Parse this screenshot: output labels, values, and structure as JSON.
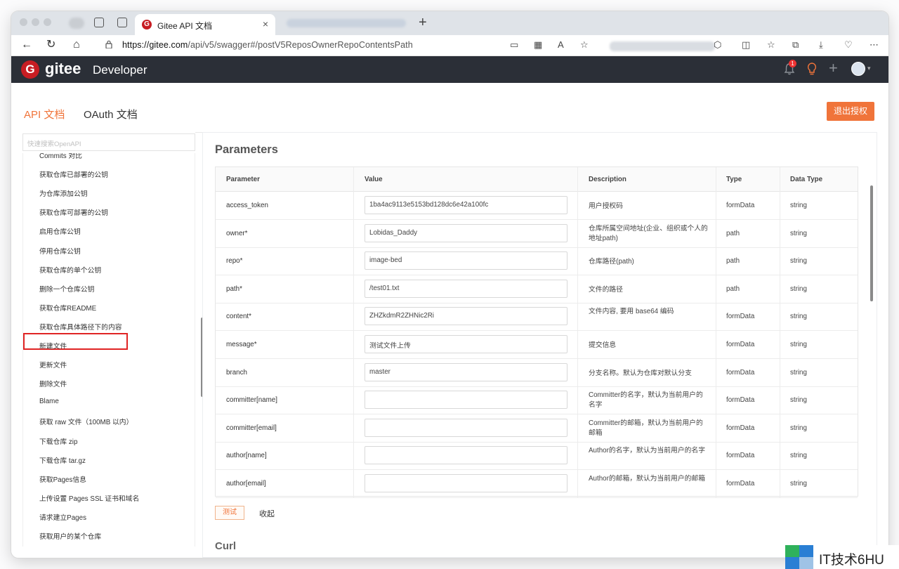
{
  "browser": {
    "tab_title": "Gitee API 文档",
    "tab_close": "×",
    "new_tab": "+",
    "url_host": "https://gitee.com",
    "url_path": "/api/v5/swagger#/postV5ReposOwnerRepoContentsPath"
  },
  "header": {
    "logo_letter": "G",
    "brand": "gitee",
    "section": "Developer",
    "notification_count": "1",
    "plus": "+",
    "caret": "▾"
  },
  "nav": {
    "api_tab": "API 文档",
    "oauth_tab": "OAuth 文档",
    "logout_button": "退出授权"
  },
  "sidebar": {
    "search_placeholder": "快速搜索OpenAPI",
    "items": [
      "Commits 对比",
      "获取仓库已部署的公钥",
      "为仓库添加公钥",
      "获取仓库可部署的公钥",
      "启用仓库公钥",
      "停用仓库公钥",
      "获取仓库的单个公钥",
      "删除一个仓库公钥",
      "获取仓库README",
      "获取仓库具体路径下的内容",
      "新建文件",
      "更新文件",
      "删除文件",
      "Blame",
      "获取 raw 文件（100MB 以内）",
      "下载仓库 zip",
      "下载仓库 tar.gz",
      "获取Pages信息",
      "上传设置 Pages SSL 证书和域名",
      "请求建立Pages",
      "获取用户的某个仓库"
    ]
  },
  "main": {
    "title": "Parameters",
    "columns": {
      "parameter": "Parameter",
      "value": "Value",
      "description": "Description",
      "type": "Type",
      "data_type": "Data Type"
    },
    "rows": [
      {
        "name": "access_token",
        "value": "1ba4ac9113e5153bd128dc6e42a100fc",
        "desc": "用户授权码",
        "type": "formData",
        "dtype": "string"
      },
      {
        "name": "owner*",
        "value": "Lobidas_Daddy",
        "desc": "仓库所属空间地址(企业、组织或个人的地址path)",
        "type": "path",
        "dtype": "string"
      },
      {
        "name": "repo*",
        "value": "image-bed",
        "desc": "仓库路径(path)",
        "type": "path",
        "dtype": "string"
      },
      {
        "name": "path*",
        "value": "/test01.txt",
        "desc": "文件的路径",
        "type": "path",
        "dtype": "string"
      },
      {
        "name": "content*",
        "value": "ZHZkdmR2ZHNic2Ri",
        "desc": "文件内容, 要用 base64 编码",
        "type": "formData",
        "dtype": "string"
      },
      {
        "name": "message*",
        "value": "测试文件上传",
        "desc": "提交信息",
        "type": "formData",
        "dtype": "string"
      },
      {
        "name": "branch",
        "value": "master",
        "desc": "分支名称。默认为仓库对默认分支",
        "type": "formData",
        "dtype": "string"
      },
      {
        "name": "committer[name]",
        "value": "",
        "desc": "Committer的名字，默认为当前用户的名字",
        "type": "formData",
        "dtype": "string"
      },
      {
        "name": "committer[email]",
        "value": "",
        "desc": "Committer的邮箱，默认为当前用户的邮箱",
        "type": "formData",
        "dtype": "string"
      },
      {
        "name": "author[name]",
        "value": "",
        "desc": "Author的名字，默认为当前用户的名字",
        "type": "formData",
        "dtype": "string"
      },
      {
        "name": "author[email]",
        "value": "",
        "desc": "Author的邮箱，默认为当前用户的邮箱",
        "type": "formData",
        "dtype": "string"
      }
    ],
    "test_button": "测试",
    "collapse_link": "收起",
    "next_section": "Curl"
  },
  "watermark": {
    "text": "IT技术6HU"
  },
  "colors": {
    "accent": "#f0743a",
    "header_bg": "#2b2f37",
    "brand_red": "#c71d23",
    "highlight_box": "#e02424"
  }
}
